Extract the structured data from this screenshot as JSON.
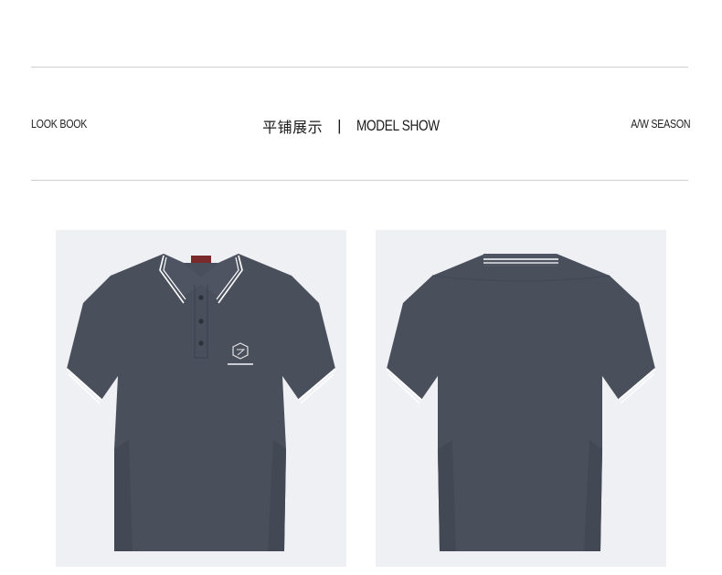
{
  "header": {
    "left_label": "LOOK BOOK",
    "title_cn": "平铺展示",
    "separator": "|",
    "title_en": "MODEL SHOW",
    "right_label": "A/W SEASON"
  },
  "colors": {
    "shirt": "#4a4f5c",
    "shirt_shadow": "#3f4451",
    "collar_stripe": "#ffffff",
    "panel_bg": "#eef0f3",
    "rule": "#cfcfcf"
  },
  "products": [
    {
      "view": "front",
      "icon": "polo-shirt-front-icon"
    },
    {
      "view": "back",
      "icon": "polo-shirt-back-icon"
    }
  ]
}
